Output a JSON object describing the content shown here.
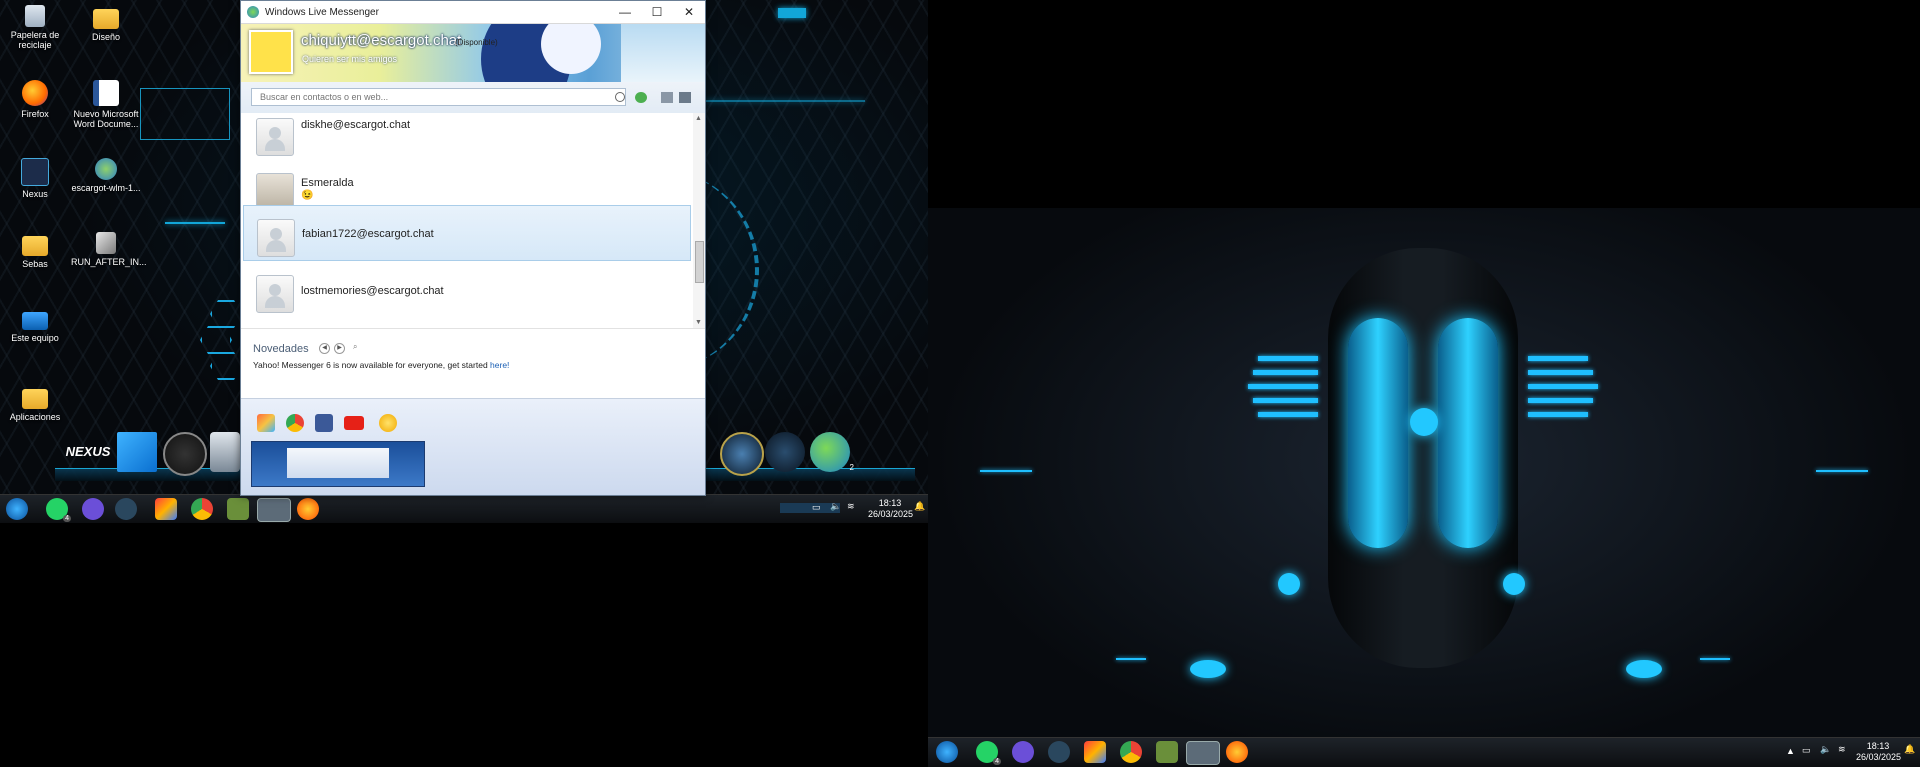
{
  "desktop1": {
    "icons": [
      {
        "label": "Papelera de reciclaje"
      },
      {
        "label": "Diseño"
      },
      {
        "label": "Firefox"
      },
      {
        "label": "Nuevo Microsoft Word Docume..."
      },
      {
        "label": "Nexus"
      },
      {
        "label": "escargot-wlm-1..."
      },
      {
        "label": "Sebas"
      },
      {
        "label": "RUN_AFTER_IN..."
      },
      {
        "label": "Este equipo"
      },
      {
        "label": "Aplicaciones"
      }
    ],
    "dock_logo": "NEXUS",
    "dock_badge": "2"
  },
  "wlm": {
    "title": "Windows Live Messenger",
    "email": "chiquiytt@escargot.chat",
    "status": "(Disponible)",
    "psm": "Quieren ser mis amigos",
    "search_placeholder": "Buscar en contactos o en web...",
    "contacts": [
      {
        "name": "diskhe@escargot.chat",
        "psm": ""
      },
      {
        "name": "Esmeralda",
        "psm": "😉"
      },
      {
        "name": "fabian1722@escargot.chat",
        "psm": ""
      },
      {
        "name": "lostmemories@escargot.chat",
        "psm": ""
      }
    ],
    "news": {
      "title": "Novedades",
      "text": "Yahoo! Messenger 6 is now available for everyone, get started ",
      "link": "here!"
    }
  },
  "taskbar1": {
    "time": "18:13",
    "date": "26/03/2025",
    "whatsapp_badge": "4"
  },
  "taskbar2": {
    "time": "18:13",
    "date": "26/03/2025",
    "whatsapp_badge": "4"
  },
  "colors": {
    "accent": "#1cb7ea",
    "wlm_link": "#1a5fb4",
    "taskbar": "#14181d"
  }
}
